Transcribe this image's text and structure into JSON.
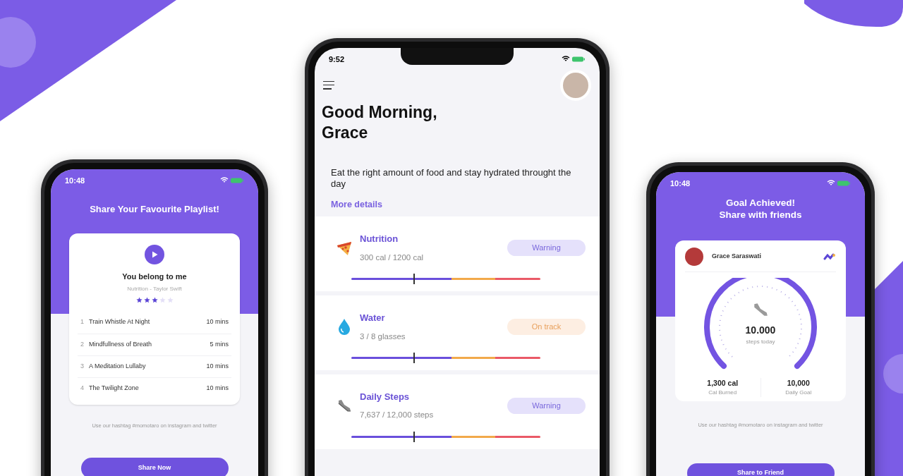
{
  "playlist_phone": {
    "time": "10:48",
    "title": "Share Your Favourite Playlist!",
    "song": {
      "title": "You belong to me",
      "subtitle": "Nutrition - Taylor Swift",
      "stars": 3
    },
    "tracks": [
      {
        "number": "1",
        "name": "Train Whistle At Night",
        "duration": "10 mins"
      },
      {
        "number": "2",
        "name": "Mindfullness of Breath",
        "duration": "5 mins"
      },
      {
        "number": "3",
        "name": "A Meditation Lullaby",
        "duration": "10 mins"
      },
      {
        "number": "4",
        "name": "The Twilight Zone",
        "duration": "10 mins"
      }
    ],
    "hashtag_note": "Use our hashtag #momotaro on instagram and twitter",
    "button": "Share Now"
  },
  "home_phone": {
    "time": "9:52",
    "greeting": "Good Morning, Grace",
    "description": "Eat the right amount of food and stay hydrated throught the day",
    "link": "More details",
    "metrics": [
      {
        "kind": "nutrition",
        "name": "Nutrition",
        "value": "300 cal / 1200 cal",
        "status": {
          "kind": "warning",
          "label": "Warning"
        },
        "level": 0.33
      },
      {
        "kind": "water",
        "name": "Water",
        "value": "3 / 8 glasses",
        "status": {
          "kind": "on_track",
          "label": "On track"
        },
        "level": 0.33
      },
      {
        "kind": "steps",
        "name": "Daily Steps",
        "value": "7,637 / 12,000 steps",
        "status": {
          "kind": "warning",
          "label": "Warning"
        },
        "level": 0.33
      }
    ]
  },
  "goal_phone": {
    "time": "10:48",
    "title_lines": [
      "Goal Achieved!",
      "Share with friends"
    ],
    "user": "Grace Saraswati",
    "steps": "10.000",
    "steps_caption": "steps today",
    "stats": [
      {
        "value": "1,300 cal",
        "label": "Cal Burned"
      },
      {
        "value": "10,000",
        "label": "Daily Goal"
      }
    ],
    "hashtag_note": "Use our hashtag #momotaro on instagram and twitter",
    "button": "Share to Friend"
  }
}
